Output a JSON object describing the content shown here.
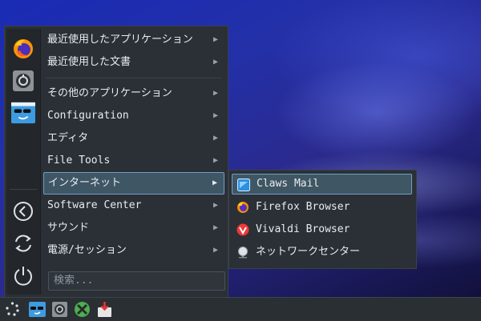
{
  "menu": {
    "sidebar": {
      "icons": [
        "firefox-icon",
        "settings-manager-icon",
        "user-avatar-icon",
        "logout-icon",
        "switch-user-icon",
        "power-icon"
      ]
    },
    "items": [
      {
        "label": "最近使用したアプリケーション"
      },
      {
        "label": "最近使用した文書"
      },
      {
        "label": "その他のアプリケーション"
      },
      {
        "label": "Configuration"
      },
      {
        "label": "エディタ"
      },
      {
        "label": "File Tools"
      },
      {
        "label": "インターネット"
      },
      {
        "label": "Software Center"
      },
      {
        "label": "サウンド"
      },
      {
        "label": "電源/セッション"
      }
    ],
    "arrow": "▶",
    "search_placeholder": "検索..."
  },
  "submenu": {
    "items": [
      {
        "label": "Claws Mail",
        "icon": "claws-mail-icon"
      },
      {
        "label": "Firefox Browser",
        "icon": "firefox-icon"
      },
      {
        "label": "Vivaldi Browser",
        "icon": "vivaldi-icon"
      },
      {
        "label": "ネットワークセンター",
        "icon": "network-center-icon"
      }
    ]
  },
  "taskbar": {
    "icons": [
      "app-launcher-icon",
      "user-avatar-icon",
      "settings-manager-icon",
      "system-tools-icon",
      "software-install-icon"
    ]
  }
}
